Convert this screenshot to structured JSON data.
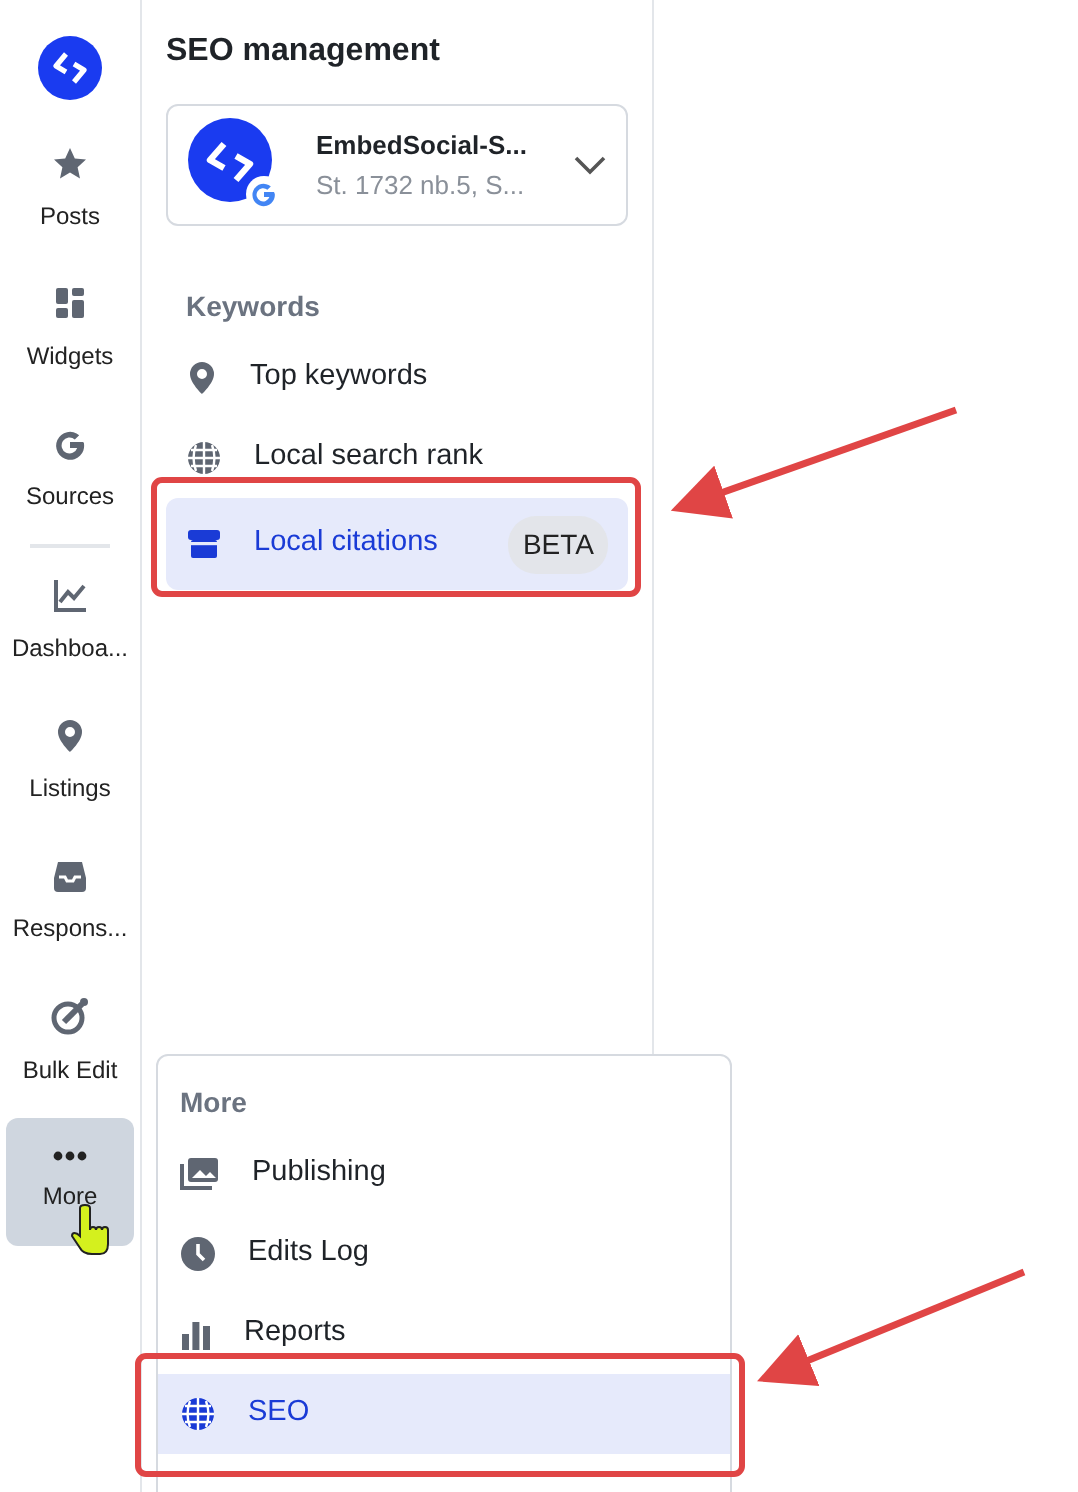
{
  "rail_groups": [
    [
      {
        "label": "Posts",
        "selected": false
      },
      {
        "label": "Widgets",
        "selected": false
      },
      {
        "label": "Sources",
        "selected": false
      }
    ],
    [
      {
        "label": "Dashboa...",
        "selected": false
      },
      {
        "label": "Listings",
        "selected": false
      },
      {
        "label": "Respons...",
        "selected": false
      },
      {
        "label": "Bulk Edit",
        "selected": false
      },
      {
        "label": "More",
        "selected": true
      }
    ]
  ],
  "panel": {
    "title": "SEO management",
    "account": {
      "name": "EmbedSocial-S...",
      "address": "St. 1732 nb.5, S..."
    },
    "section": "Keywords",
    "items": [
      {
        "label": "Top keywords",
        "selected": false
      },
      {
        "label": "Local search rank",
        "selected": false
      },
      {
        "label": "Local citations",
        "selected": true,
        "badge": "BETA"
      }
    ]
  },
  "more_menu": {
    "title": "More",
    "items": [
      {
        "label": "Publishing",
        "selected": false
      },
      {
        "label": "Edits Log",
        "selected": false
      },
      {
        "label": "Reports",
        "selected": false
      },
      {
        "label": "SEO",
        "selected": true
      }
    ]
  }
}
